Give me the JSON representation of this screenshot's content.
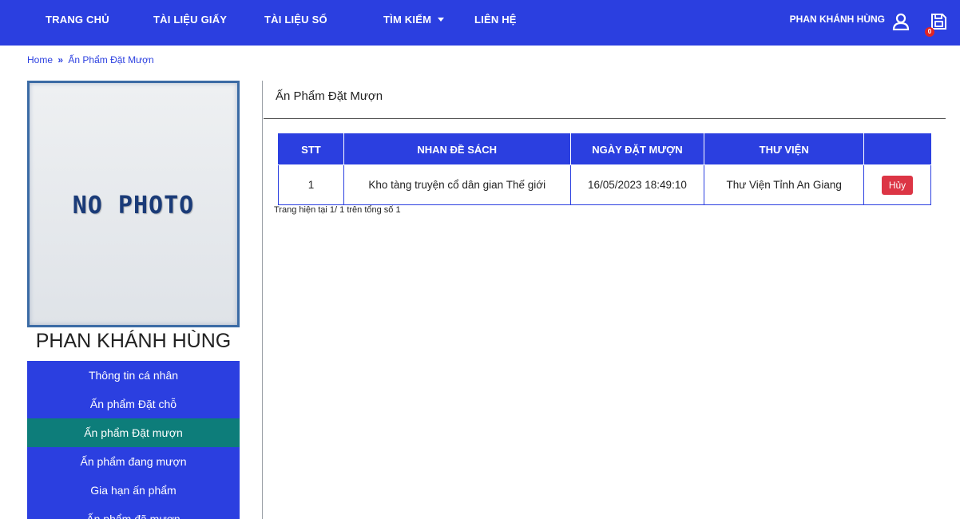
{
  "nav": {
    "home": "TRANG CHỦ",
    "paper_docs": "TÀI LIỆU GIẤY",
    "digital_docs": "TÀI LIỆU SỐ",
    "search": "TÌM KIẾM",
    "contact": "LIÊN HỆ",
    "user_name": "PHAN KHÁNH HÙNG",
    "cart_count": "0"
  },
  "breadcrumb": {
    "home": "Home",
    "separator": "»",
    "current": "Ấn Phẩm Đặt Mượn"
  },
  "profile": {
    "photo_text": "NO PHOTO",
    "name": "PHAN KHÁNH HÙNG"
  },
  "menu": {
    "items": [
      {
        "label": "Thông tin cá nhân"
      },
      {
        "label": "Ấn phẩm Đặt chỗ"
      },
      {
        "label": "Ấn phẩm Đặt mượn"
      },
      {
        "label": "Ấn phẩm đang mượn"
      },
      {
        "label": "Gia hạn ấn phẩm"
      },
      {
        "label": "Ấn phẩm đã mượn"
      }
    ]
  },
  "main": {
    "title": "Ấn Phẩm Đặt Mượn",
    "table": {
      "headers": [
        "STT",
        "NHAN ĐỀ SÁCH",
        "NGÀY ĐẶT MƯỢN",
        "THƯ VIỆN",
        ""
      ],
      "rows": [
        {
          "stt": "1",
          "title": "Kho tàng truyện cổ dân gian Thế giới",
          "date": "16/05/2023 18:49:10",
          "library": "Thư Viện Tỉnh An Giang",
          "action": "Hủy"
        }
      ]
    },
    "pager": "Trang hiện tại 1/ 1 trên tổng số 1"
  },
  "colors": {
    "primary": "#2b3fe0",
    "active_menu": "#0d7d7a",
    "danger": "#dc3545"
  }
}
